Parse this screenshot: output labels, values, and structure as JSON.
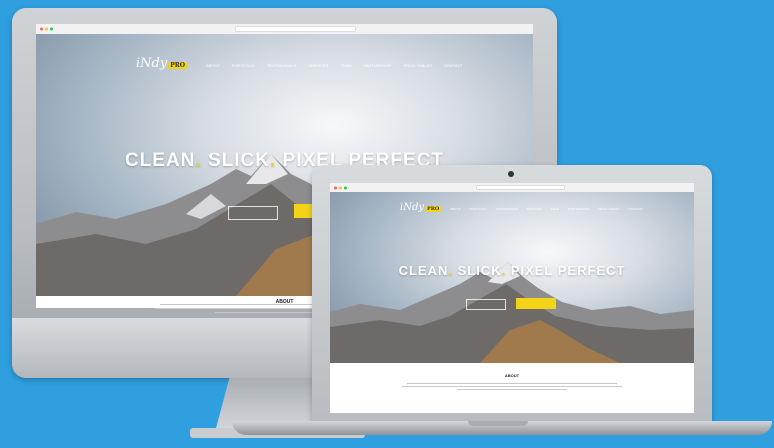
{
  "brand": {
    "logo_text": "iNdy",
    "logo_badge": "PRO"
  },
  "nav": [
    "ABOUT",
    "PORTFOLIO",
    "TESTIMONIALS",
    "SERVICES",
    "TEAM",
    "PARTNERSHIP",
    "PRICE TABLES",
    "CONTACT"
  ],
  "hero": {
    "headline_parts": [
      "CLEAN",
      ". ",
      "SLICK",
      ". ",
      "PIXEL PERFECT"
    ]
  },
  "about": {
    "heading": "ABOUT"
  },
  "colors": {
    "background": "#2f9fe0",
    "accent": "#f2d318"
  }
}
